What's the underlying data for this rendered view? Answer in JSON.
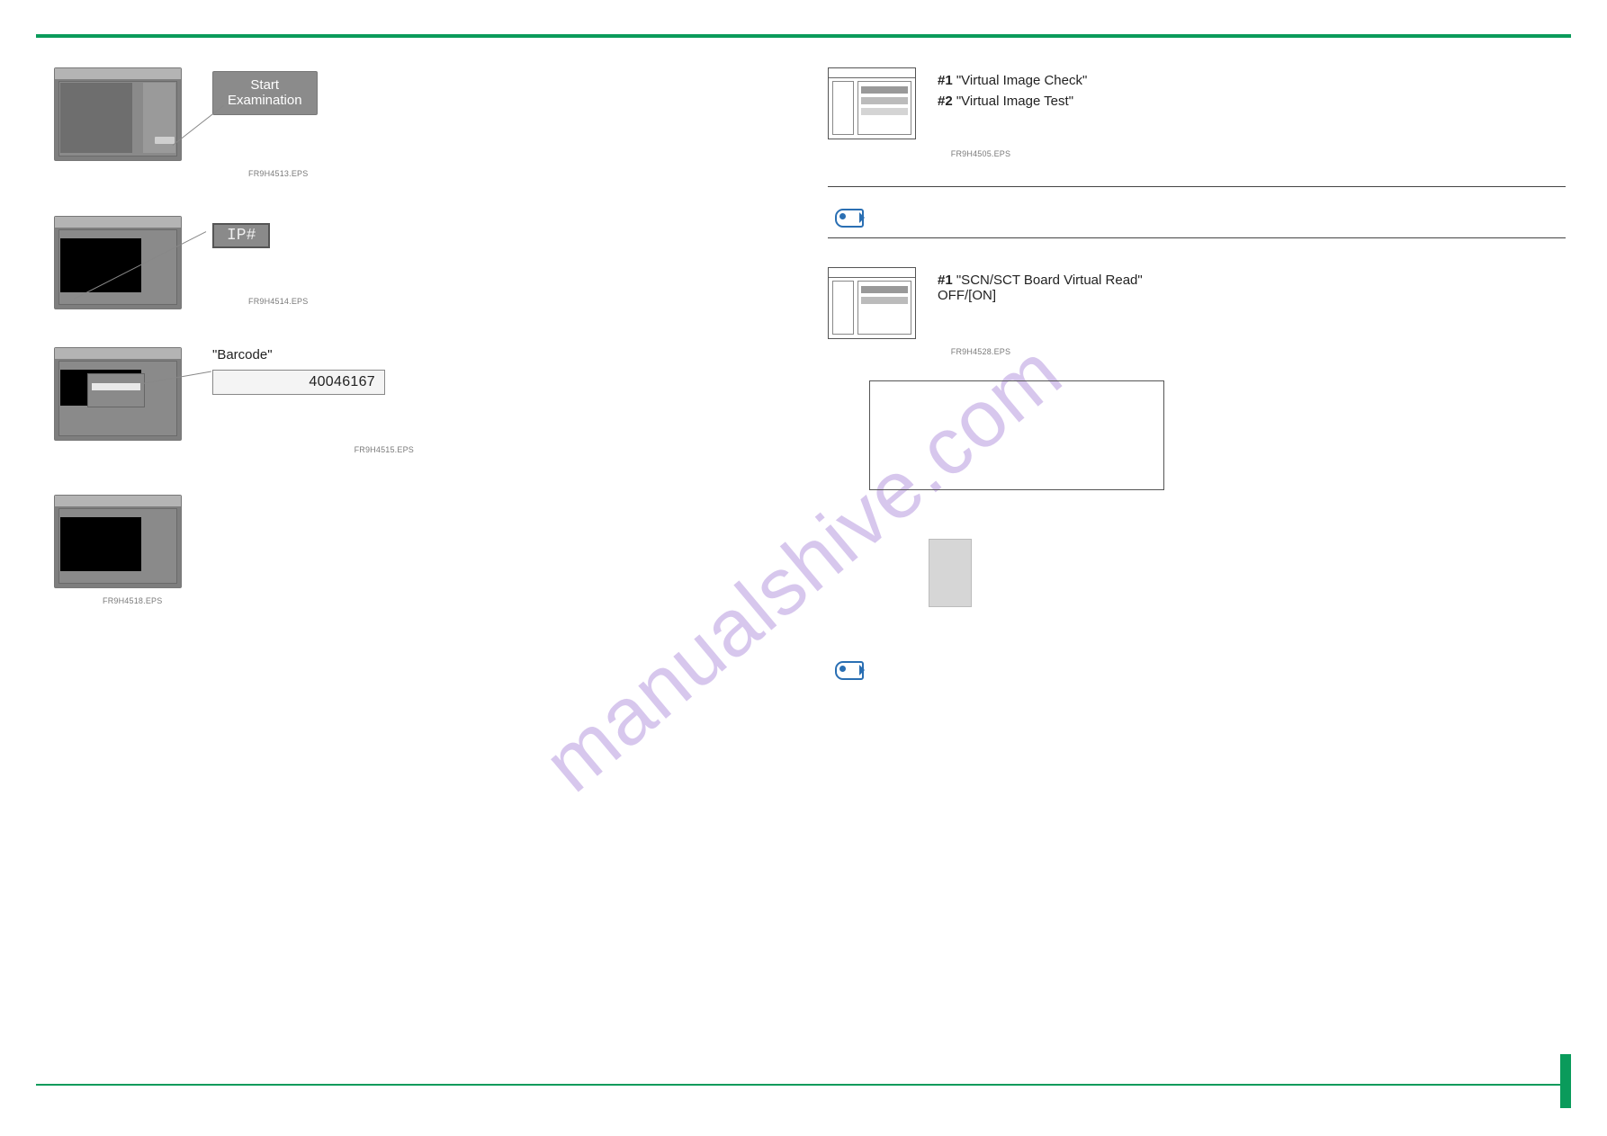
{
  "watermark": "manualshive.com",
  "left": {
    "step1": {
      "callout": "Start\nExamination",
      "eps": "FR9H4513.EPS"
    },
    "step2": {
      "callout": "IP#",
      "eps": "FR9H4514.EPS"
    },
    "step3": {
      "barcode_label": "\"Barcode\"",
      "barcode_value": "40046167",
      "eps": "FR9H4515.EPS"
    },
    "step4": {
      "eps": "FR9H4518.EPS"
    }
  },
  "right": {
    "fig1": {
      "annot1_tag": "#1",
      "annot1_text": "\"Virtual Image Check\"",
      "annot2_tag": "#2",
      "annot2_text": "\"Virtual Image Test\"",
      "eps": "FR9H4505.EPS"
    },
    "fig2": {
      "annot1_tag": "#1",
      "annot1_text": "\"SCN/SCT Board Virtual Read\" OFF/[ON]",
      "eps": "FR9H4528.EPS"
    }
  }
}
